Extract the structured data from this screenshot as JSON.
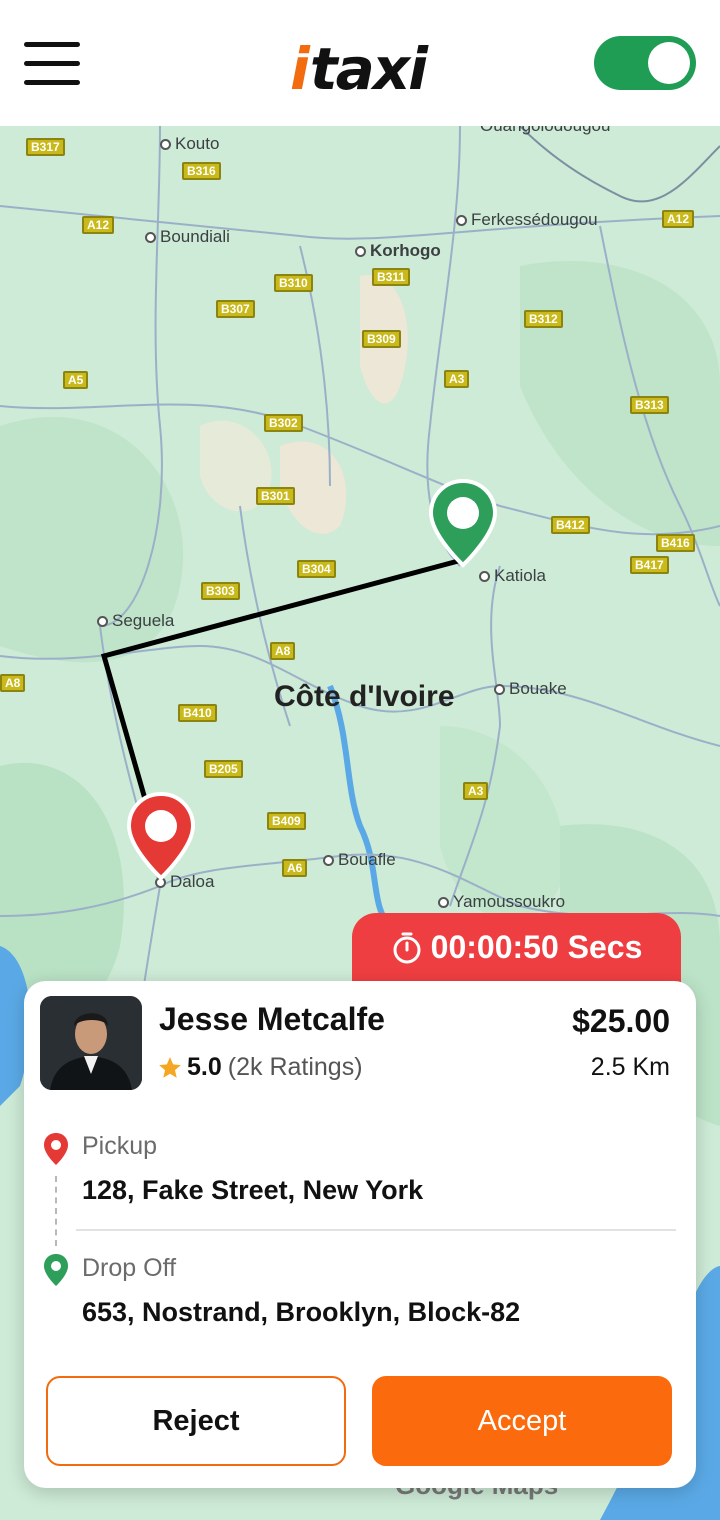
{
  "header": {
    "logo_i": "i",
    "logo_rest": "taxi",
    "online_toggle": "on"
  },
  "map": {
    "places": {
      "ouangolo": "Ouangolodougou",
      "kouto": "Kouto",
      "boundiali": "Boundiali",
      "korhogo": "Korhogo",
      "ferke": "Ferkessédougou",
      "seguela": "Seguela",
      "katiola": "Katiola",
      "bouake": "Bouake",
      "country": "Côte d'Ivoire",
      "daloa": "Daloa",
      "bouafle": "Bouafle",
      "yamoussoukro": "Yamoussoukro"
    },
    "shields": [
      "B317",
      "B316",
      "A12",
      "B310",
      "B311",
      "B307",
      "B309",
      "B312",
      "A5",
      "A3",
      "B313",
      "B302",
      "B301",
      "B412",
      "B416",
      "B417",
      "B304",
      "B303",
      "A8",
      "B410",
      "B205",
      "A3",
      "B409",
      "A6",
      "A12",
      "A8"
    ],
    "attribution": "Google Maps",
    "colors": {
      "land": "#cdebd6",
      "water": "#5aa9e6",
      "route": "#000000",
      "pickup_pin": "#e53935",
      "dropoff_pin": "#2e9e5b"
    }
  },
  "timer": {
    "label": "00:00:50 Secs",
    "icon": "stopwatch-icon",
    "color": "#ef3e41"
  },
  "ride": {
    "driver_name": "Jesse Metcalfe",
    "rating": "5.0",
    "ratings_count": "(2k Ratings)",
    "price": "$25.00",
    "distance": "2.5 Km",
    "pickup_label": "Pickup",
    "pickup_address": "128, Fake Street, New York",
    "dropoff_label": "Drop Off",
    "dropoff_address": "653, Nostrand, Brooklyn, Block-82"
  },
  "actions": {
    "reject": "Reject",
    "accept": "Accept"
  },
  "accent": "#fb6a0d"
}
